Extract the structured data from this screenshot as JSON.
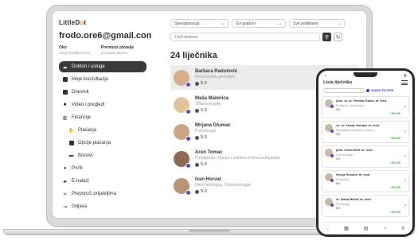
{
  "app": {
    "logo_prefix": "L",
    "logo_mid": "ittle",
    "logo_d": "D",
    "logo_o": "o",
    "logo_t": "t"
  },
  "account": {
    "email": "frodo.ore6@gmail.com",
    "credit_title": "Okn",
    "credit_sub": "stanje kredita bonsi",
    "premium_title": "Premium zdravlje",
    "premium_sub": "pretplata aktivna"
  },
  "sidebar": {
    "items": [
      {
        "label": "Doktori / usluge",
        "icon": "cloud-icon"
      },
      {
        "label": "Moje konzultacije",
        "icon": "chat-icon"
      },
      {
        "label": "Dnevnik",
        "icon": "book-icon"
      },
      {
        "label": "Video i pregledi",
        "icon": "video-icon"
      },
      {
        "label": "Financije",
        "icon": "bank-icon"
      },
      {
        "label": "Plaćanja",
        "icon": "hand-coin-icon"
      },
      {
        "label": "Opcije plaćanja",
        "icon": "card-icon"
      },
      {
        "label": "Bonovi",
        "icon": "voucher-icon"
      },
      {
        "label": "Profil",
        "icon": "person-icon"
      },
      {
        "label": "E-nalazi",
        "icon": "folder-icon"
      },
      {
        "label": "Preporuči prijateljima",
        "icon": "share-icon"
      },
      {
        "label": "Odjava",
        "icon": "logout-icon"
      }
    ]
  },
  "filters": {
    "specialization": "Specijalizacija",
    "city": "Svi gradovi",
    "clinic": "Sve poliklinike"
  },
  "search": {
    "placeholder": "Traži doktora"
  },
  "results": {
    "title": "24 liječnika"
  },
  "doctors": [
    {
      "name": "Barbara Radulović",
      "specialty": "Medicinska genetika",
      "rating": "5.0",
      "avatar_color": "#d6b08a"
    },
    {
      "name": "Maša Malenica",
      "specialty": "Oftalmologija",
      "rating": "5.0",
      "avatar_color": "#e2c59c"
    },
    {
      "name": "Mirjana Glumac",
      "specialty": "Psihologija",
      "rating": "5.0",
      "avatar_color": "#c9a584"
    },
    {
      "name": "Aron Tomac",
      "specialty": "Psihijatrija, Dječja i adolescentna psihijatrija",
      "rating": "5.0",
      "avatar_color": "#8f6a52"
    },
    {
      "name": "Ivan Horvat",
      "specialty": "Dermatologija, Dijabetologija",
      "rating": "5.0",
      "avatar_color": "#b89478"
    }
  ],
  "phone": {
    "title": "Lista liječnika",
    "filter_label": "SAKRIJ FILTERE",
    "online_label": "ONLINE",
    "cards": [
      {
        "name": "prim. dr. sc. Renata Vrabec dr. med.",
        "spec": "Pedijatrija i alergologija",
        "rating": "5.0"
      },
      {
        "name": "mr. sc. Dunja Vodopić dr. med.",
        "spec": "Specijalistica obiteljske medicine",
        "rating": "5.0"
      },
      {
        "name": "prim. Zoran Belić dr. med.",
        "spec": "Opća kirurgija",
        "rating": "5.0"
      },
      {
        "name": "Hrvoje Šimunić dr. med.",
        "spec": "Ortopedija",
        "rating": "5.0"
      },
      {
        "name": "dr. Diana Marčić dr. med.",
        "spec": "Neurologija",
        "rating": "5.0"
      }
    ]
  }
}
